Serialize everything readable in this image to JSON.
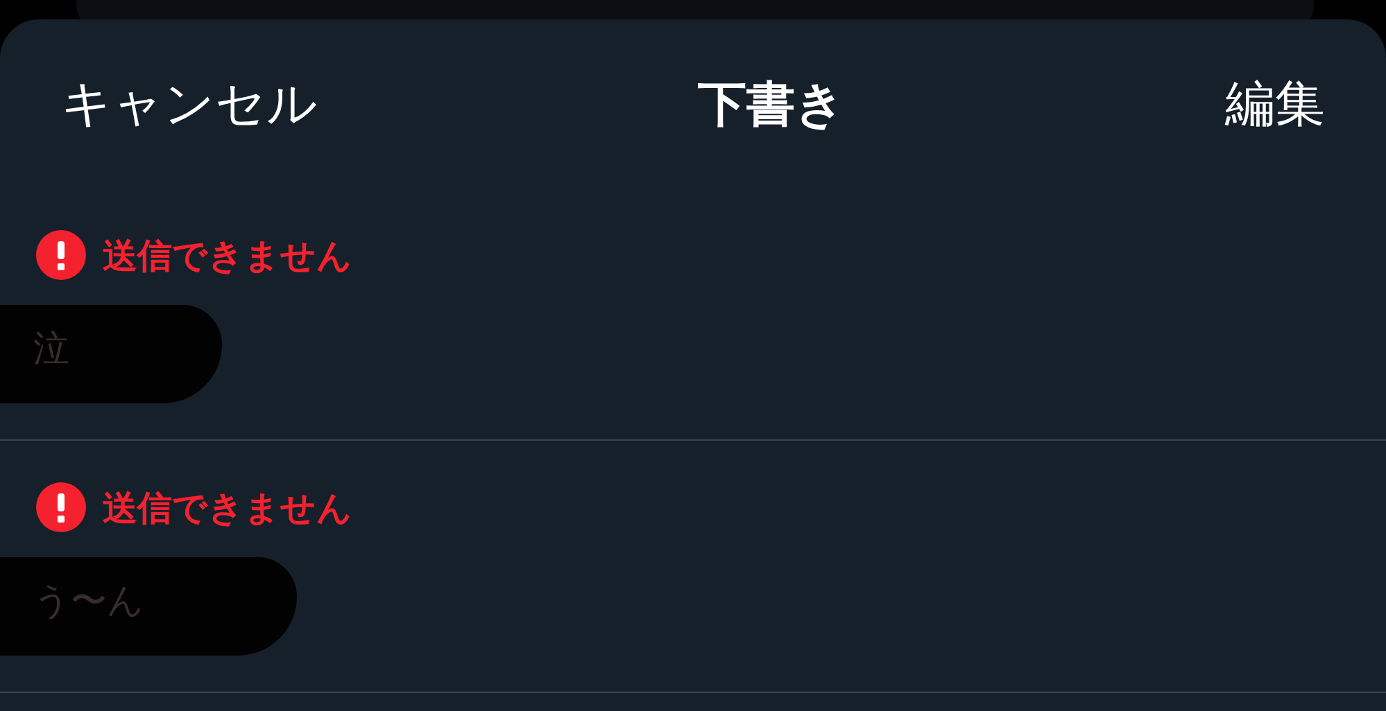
{
  "header": {
    "cancel": "キャンセル",
    "title": "下書き",
    "edit": "編集"
  },
  "drafts": [
    {
      "status": "送信できません",
      "text": "泣",
      "redacted": true
    },
    {
      "status": "送信できません",
      "text": "う〜ん",
      "redacted": true
    }
  ]
}
